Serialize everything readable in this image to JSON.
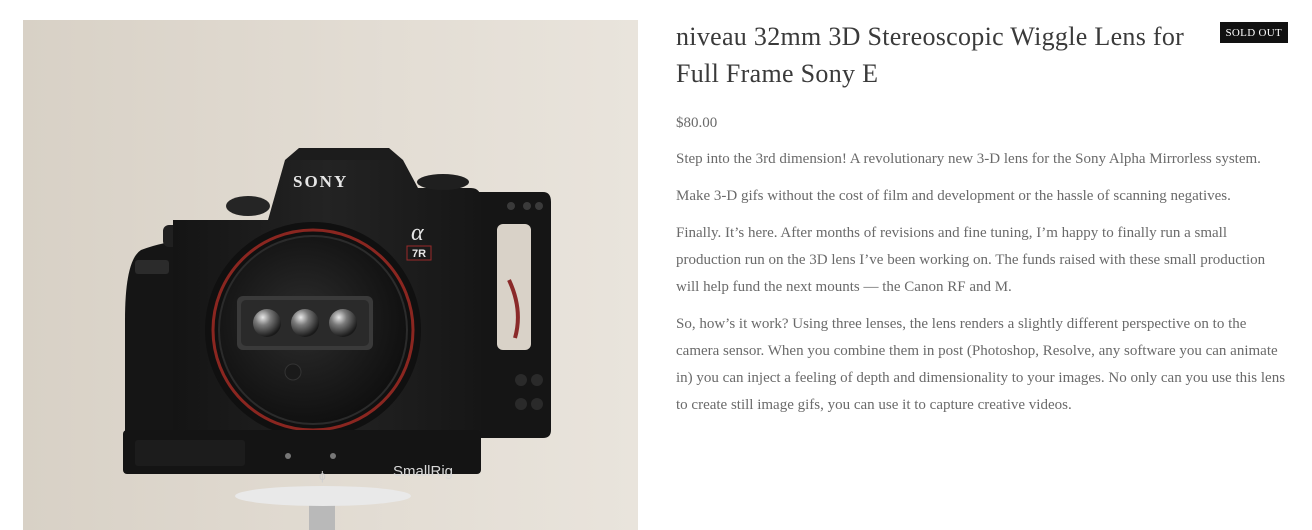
{
  "product": {
    "image": {
      "brand_text": "SONY",
      "model_alpha": "α",
      "model_text": "7R",
      "cage_brand": "SmallRig"
    },
    "title": "niveau 32mm 3D Stereoscopic Wiggle Lens for Full Frame Sony E",
    "badge": "SOLD OUT",
    "price": "$80.00",
    "description": [
      "Step into the 3rd dimension! A revolutionary new 3-D lens for the Sony Alpha Mirrorless system.",
      "Make 3-D gifs without the cost of film and development or the hassle of scanning negatives.",
      "Finally. It’s here. After months of revisions and fine tuning, I’m happy to finally run a small production run on the 3D lens I’ve been working on. The funds raised with these small production will help fund the next mounts — the Canon RF and M.",
      "So, how’s it work? Using three lenses, the lens renders a slightly different perspective on to the camera sensor. When you combine them in post (Photoshop, Resolve, any software you can animate in) you can inject a feeling of depth and dimensionality to your images. No only can you use this lens to create still image gifs, you can use it to capture creative videos."
    ]
  },
  "colors": {
    "background": "#ffffff",
    "text": "#6a6a6a",
    "title": "#3a3a3a",
    "badge_bg": "#111111",
    "badge_text": "#ffffff",
    "image_wall": "#ddd6cc",
    "camera_body": "#1e1e1e"
  }
}
